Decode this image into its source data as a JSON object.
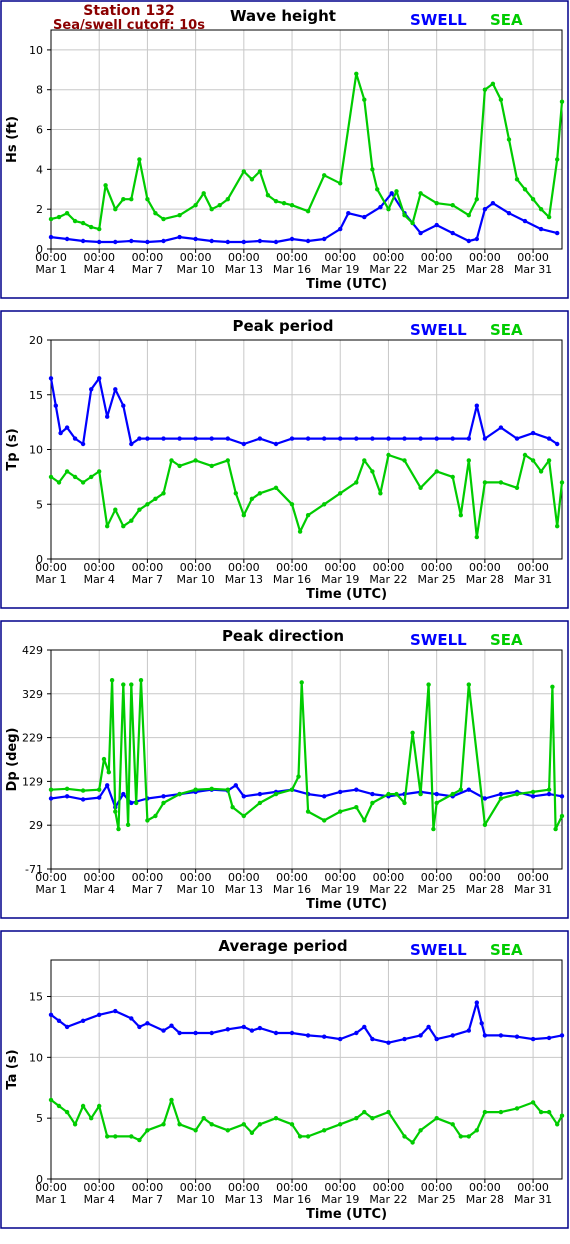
{
  "station": {
    "name": "Station 132",
    "cutoff": "Sea/swell cutoff: 10s"
  },
  "legend": {
    "swell": "SWELL",
    "sea": "SEA"
  },
  "colors": {
    "swell": "#0000ff",
    "sea": "#00cc00",
    "frame": "#00008b",
    "station": "#8b0000",
    "grid": "#c8c8c8"
  },
  "x_ticks": [
    {
      "time": "00:00",
      "date": "Mar 1",
      "day": 0
    },
    {
      "time": "00:00",
      "date": "Mar 4",
      "day": 3
    },
    {
      "time": "00:00",
      "date": "Mar 7",
      "day": 6
    },
    {
      "time": "00:00",
      "date": "Mar 10",
      "day": 9
    },
    {
      "time": "00:00",
      "date": "Mar 13",
      "day": 12
    },
    {
      "time": "00:00",
      "date": "Mar 16",
      "day": 15
    },
    {
      "time": "00:00",
      "date": "Mar 19",
      "day": 18
    },
    {
      "time": "00:00",
      "date": "Mar 22",
      "day": 21
    },
    {
      "time": "00:00",
      "date": "Mar 25",
      "day": 24
    },
    {
      "time": "00:00",
      "date": "Mar 28",
      "day": 27
    },
    {
      "time": "00:00",
      "date": "Mar 31",
      "day": 30
    }
  ],
  "chart_data": [
    {
      "type": "line",
      "title": "Wave height",
      "xlabel": "Time (UTC)",
      "ylabel": "Hs (ft)",
      "xlim": [
        0,
        31.8
      ],
      "ylim": [
        0,
        11
      ],
      "yticks": [
        0,
        2,
        4,
        6,
        8,
        10
      ],
      "grid": true,
      "legend_position": "top-right",
      "series": [
        {
          "name": "SWELL",
          "x": [
            0,
            1,
            2,
            3,
            4,
            5,
            6,
            7,
            8,
            9,
            10,
            11,
            12,
            13,
            14,
            15,
            16,
            17,
            18,
            18.5,
            19.5,
            20.5,
            21.2,
            22,
            23,
            24,
            25,
            26,
            26.5,
            27,
            27.5,
            28.5,
            29.5,
            30.5,
            31.5
          ],
          "y": [
            0.6,
            0.5,
            0.4,
            0.35,
            0.35,
            0.4,
            0.35,
            0.4,
            0.6,
            0.5,
            0.4,
            0.35,
            0.35,
            0.4,
            0.35,
            0.5,
            0.4,
            0.5,
            1.0,
            1.8,
            1.6,
            2.1,
            2.8,
            1.8,
            0.8,
            1.2,
            0.8,
            0.4,
            0.5,
            2.0,
            2.3,
            1.8,
            1.4,
            1.0,
            0.8
          ]
        },
        {
          "name": "SEA",
          "x": [
            0,
            0.5,
            1,
            1.5,
            2,
            2.5,
            3,
            3.4,
            4,
            4.5,
            5,
            5.5,
            6,
            6.5,
            7,
            8,
            9,
            9.5,
            10,
            10.5,
            11,
            12,
            12.5,
            13,
            13.5,
            14,
            14.5,
            15,
            16,
            17,
            18,
            19,
            19.5,
            20,
            20.3,
            21,
            21.5,
            22,
            22.5,
            23,
            24,
            25,
            26,
            26.5,
            27,
            27.5,
            28,
            28.5,
            29,
            29.5,
            30,
            30.5,
            31,
            31.5,
            31.8
          ],
          "y": [
            1.5,
            1.6,
            1.8,
            1.4,
            1.3,
            1.1,
            1.0,
            3.2,
            2.0,
            2.5,
            2.5,
            4.5,
            2.5,
            1.8,
            1.5,
            1.7,
            2.2,
            2.8,
            2.0,
            2.2,
            2.5,
            3.9,
            3.5,
            3.9,
            2.7,
            2.4,
            2.3,
            2.2,
            1.9,
            3.7,
            3.3,
            8.8,
            7.5,
            4.0,
            3.0,
            2.0,
            2.9,
            1.7,
            1.3,
            2.8,
            2.3,
            2.2,
            1.7,
            2.5,
            8.0,
            8.3,
            7.5,
            5.5,
            3.5,
            3.0,
            2.5,
            2.0,
            1.6,
            4.5,
            7.4
          ]
        }
      ]
    },
    {
      "type": "scatter",
      "title": "Peak period",
      "xlabel": "Time (UTC)",
      "ylabel": "Tp (s)",
      "xlim": [
        0,
        31.8
      ],
      "ylim": [
        0,
        20
      ],
      "yticks": [
        0,
        5,
        10,
        15,
        20
      ],
      "grid": true,
      "legend_position": "top-right",
      "series": [
        {
          "name": "SWELL",
          "x": [
            0,
            0.3,
            0.6,
            1,
            1.5,
            2,
            2.5,
            3,
            3.5,
            4,
            4.5,
            5,
            5.5,
            6,
            7,
            8,
            9,
            10,
            11,
            12,
            13,
            14,
            15,
            16,
            17,
            18,
            19,
            20,
            21,
            22,
            23,
            24,
            25,
            26,
            26.5,
            27,
            28,
            29,
            30,
            31,
            31.5
          ],
          "y": [
            16.5,
            14,
            11.5,
            12,
            11,
            10.5,
            15.5,
            16.5,
            13,
            15.5,
            14,
            10.5,
            11,
            11,
            11,
            11,
            11,
            11,
            11,
            10.5,
            11,
            10.5,
            11,
            11,
            11,
            11,
            11,
            11,
            11,
            11,
            11,
            11,
            11,
            11,
            14,
            11,
            12,
            11,
            11.5,
            11,
            10.5
          ]
        },
        {
          "name": "SEA",
          "x": [
            0,
            0.5,
            1,
            1.5,
            2,
            2.5,
            3,
            3.5,
            4,
            4.5,
            5,
            5.5,
            6,
            6.5,
            7,
            7.5,
            8,
            9,
            10,
            11,
            11.5,
            12,
            12.5,
            13,
            14,
            15,
            15.5,
            16,
            17,
            18,
            19,
            19.5,
            20,
            20.5,
            21,
            22,
            23,
            24,
            25,
            25.5,
            26,
            26.5,
            27,
            28,
            29,
            29.5,
            30,
            30.5,
            31,
            31.5,
            31.8
          ],
          "y": [
            7.5,
            7,
            8,
            7.5,
            7,
            7.5,
            8,
            3,
            4.5,
            3,
            3.5,
            4.5,
            5,
            5.5,
            6,
            9,
            8.5,
            9,
            8.5,
            9,
            6,
            4,
            5.5,
            6,
            6.5,
            5,
            2.5,
            4,
            5,
            6,
            7,
            9,
            8,
            6,
            9.5,
            9,
            6.5,
            8,
            7.5,
            4,
            9,
            2,
            7,
            7,
            6.5,
            9.5,
            9,
            8,
            9,
            3,
            7
          ]
        }
      ]
    },
    {
      "type": "scatter",
      "title": "Peak direction",
      "xlabel": "Time (UTC)",
      "ylabel": "Dp (deg)",
      "xlim": [
        0,
        31.8
      ],
      "ylim": [
        -71,
        429
      ],
      "yticks": [
        -71,
        29,
        129,
        229,
        329,
        429
      ],
      "grid": true,
      "legend_position": "top-right",
      "series": [
        {
          "name": "SWELL",
          "x": [
            0,
            1,
            2,
            3,
            3.5,
            4,
            4.5,
            5,
            6,
            7,
            8,
            9,
            10,
            11,
            11.5,
            12,
            13,
            14,
            15,
            16,
            17,
            18,
            19,
            20,
            21,
            22,
            23,
            24,
            25,
            26,
            27,
            28,
            29,
            30,
            31,
            31.8
          ],
          "y": [
            90,
            95,
            88,
            92,
            120,
            70,
            100,
            80,
            90,
            95,
            100,
            105,
            110,
            108,
            120,
            95,
            100,
            105,
            110,
            100,
            95,
            105,
            110,
            100,
            95,
            100,
            105,
            100,
            95,
            110,
            90,
            100,
            105,
            95,
            100,
            95
          ]
        },
        {
          "name": "SEA",
          "x": [
            0,
            1,
            2,
            3,
            3.3,
            3.6,
            3.8,
            4,
            4.2,
            4.5,
            4.8,
            5,
            5.3,
            5.6,
            6,
            6.5,
            7,
            8,
            9,
            10,
            11,
            11.3,
            12,
            13,
            14,
            15,
            15.4,
            15.6,
            16,
            17,
            18,
            19,
            19.5,
            20,
            21,
            21.5,
            22,
            22.5,
            23,
            23.5,
            23.8,
            24,
            25,
            25.5,
            26,
            27,
            28,
            29,
            30,
            31,
            31.2,
            31.4,
            31.8
          ],
          "y": [
            110,
            112,
            108,
            110,
            180,
            150,
            360,
            60,
            20,
            350,
            30,
            350,
            80,
            360,
            40,
            50,
            80,
            100,
            110,
            112,
            110,
            70,
            50,
            80,
            100,
            110,
            140,
            355,
            60,
            40,
            60,
            70,
            40,
            80,
            100,
            100,
            80,
            240,
            100,
            350,
            20,
            80,
            100,
            110,
            350,
            30,
            90,
            100,
            105,
            110,
            345,
            20,
            50
          ]
        }
      ]
    },
    {
      "type": "line",
      "title": "Average period",
      "xlabel": "Time (UTC)",
      "ylabel": "Ta (s)",
      "xlim": [
        0,
        31.8
      ],
      "ylim": [
        0,
        18
      ],
      "yticks": [
        0,
        5,
        10,
        15
      ],
      "grid": true,
      "legend_position": "top-right",
      "series": [
        {
          "name": "SWELL",
          "x": [
            0,
            0.5,
            1,
            2,
            3,
            4,
            5,
            5.5,
            6,
            7,
            7.5,
            8,
            9,
            10,
            11,
            12,
            12.5,
            13,
            14,
            15,
            16,
            17,
            18,
            19,
            19.5,
            20,
            21,
            22,
            23,
            23.5,
            24,
            25,
            26,
            26.5,
            26.8,
            27,
            28,
            29,
            30,
            31,
            31.8
          ],
          "y": [
            13.5,
            13,
            12.5,
            13,
            13.5,
            13.8,
            13.2,
            12.5,
            12.8,
            12.2,
            12.6,
            12,
            12,
            12,
            12.3,
            12.5,
            12.2,
            12.4,
            12,
            12,
            11.8,
            11.7,
            11.5,
            12,
            12.5,
            11.5,
            11.2,
            11.5,
            11.8,
            12.5,
            11.5,
            11.8,
            12.2,
            14.5,
            12.8,
            11.8,
            11.8,
            11.7,
            11.5,
            11.6,
            11.8
          ]
        },
        {
          "name": "SEA",
          "x": [
            0,
            0.5,
            1,
            1.5,
            2,
            2.5,
            3,
            3.5,
            4,
            5,
            5.5,
            6,
            7,
            7.5,
            8,
            9,
            9.5,
            10,
            11,
            12,
            12.5,
            13,
            14,
            15,
            15.5,
            16,
            17,
            18,
            19,
            19.5,
            20,
            21,
            22,
            22.5,
            23,
            24,
            25,
            25.5,
            26,
            26.5,
            27,
            28,
            29,
            30,
            30.5,
            31,
            31.5,
            31.8
          ],
          "y": [
            6.5,
            6,
            5.5,
            4.5,
            6,
            5,
            6,
            3.5,
            3.5,
            3.5,
            3.2,
            4,
            4.5,
            6.5,
            4.5,
            4,
            5,
            4.5,
            4,
            4.5,
            3.8,
            4.5,
            5,
            4.5,
            3.5,
            3.5,
            4,
            4.5,
            5,
            5.5,
            5,
            5.5,
            3.5,
            3,
            4,
            5,
            4.5,
            3.5,
            3.5,
            4,
            5.5,
            5.5,
            5.8,
            6.3,
            5.5,
            5.5,
            4.5,
            5.2
          ]
        }
      ]
    }
  ]
}
